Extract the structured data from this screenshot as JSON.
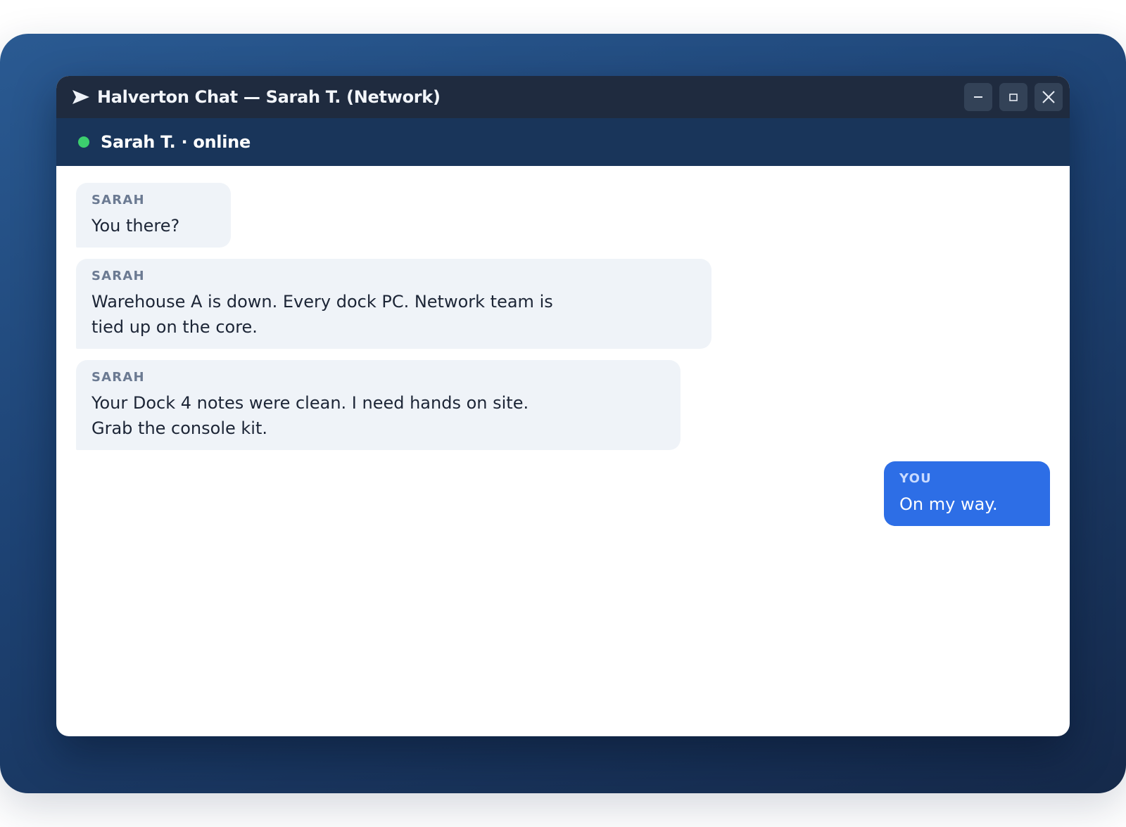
{
  "window": {
    "title": "Halverton Chat — Sarah T. (Network)",
    "controls": {
      "minimize_icon": "minimize-icon",
      "maximize_icon": "maximize-icon",
      "close_icon": "close-icon"
    }
  },
  "contact": {
    "label": "Sarah T. · online",
    "status_color": "#3ccf6e"
  },
  "messages": [
    {
      "sender": "SARAH",
      "text": "You there?",
      "direction": "incoming"
    },
    {
      "sender": "SARAH",
      "text": "Warehouse A is down. Every dock PC. Network team is\ntied up on the core.",
      "direction": "incoming"
    },
    {
      "sender": "SARAH",
      "text": "Your Dock 4 notes were clean. I need hands on site.\nGrab the console kit.",
      "direction": "incoming"
    },
    {
      "sender": "YOU",
      "text": "On my way.",
      "direction": "outgoing"
    }
  ],
  "colors": {
    "accent": "#2d6ee6",
    "titlebar": "#1f2b3f",
    "contact_bar": "#19355a",
    "incoming_bubble": "#eff3f8"
  }
}
